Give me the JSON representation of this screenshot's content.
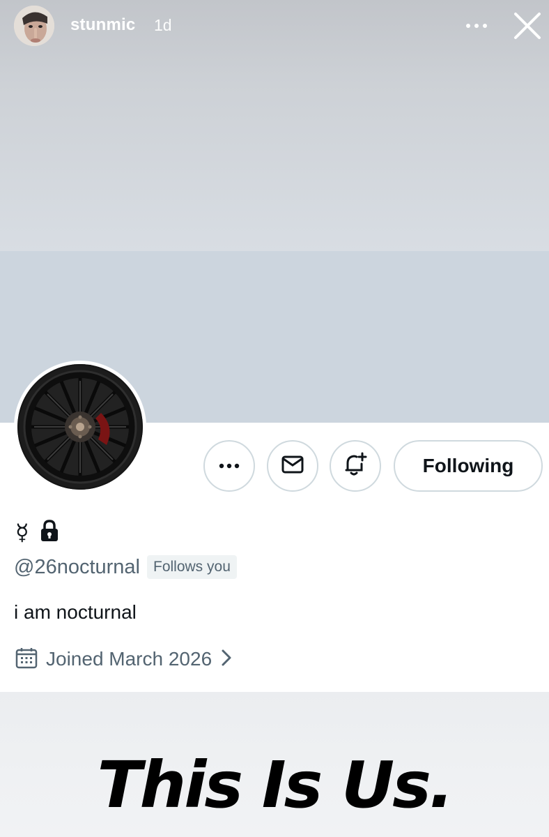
{
  "story": {
    "username": "stunmic",
    "time_ago": "1d",
    "more_icon": "more-horizontal-icon",
    "close_icon": "close-icon"
  },
  "profile": {
    "name_symbols": "☿",
    "lock_icon": "lock-icon",
    "handle": "@26nocturnal",
    "follows_you": "Follows you",
    "bio": "i am nocturnal",
    "joined": "Joined March 2026",
    "calendar_icon": "calendar-icon",
    "chevron_icon": "chevron-right-icon"
  },
  "actions": {
    "more_icon": "more-horizontal-icon",
    "message_icon": "mail-icon",
    "notify_icon": "bell-plus-icon",
    "follow_label": "Following"
  },
  "caption": {
    "text": "This Is Us."
  },
  "colors": {
    "banner": "#ccd5de",
    "secondary_text": "#536471",
    "button_border": "#cfd9de"
  }
}
